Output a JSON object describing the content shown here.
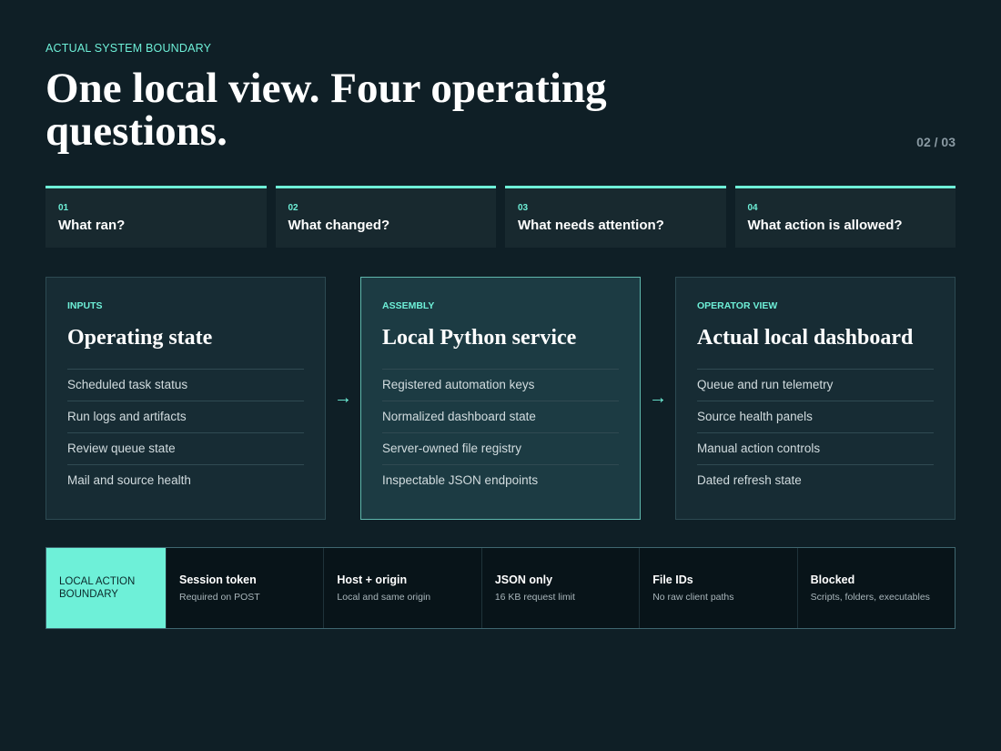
{
  "header": {
    "eyebrow": "ACTUAL SYSTEM BOUNDARY",
    "title": "One local view. Four operating questions.",
    "page": "02 / 03"
  },
  "questions": [
    {
      "num": "01",
      "text": "What ran?"
    },
    {
      "num": "02",
      "text": "What changed?"
    },
    {
      "num": "03",
      "text": "What needs attention?"
    },
    {
      "num": "04",
      "text": "What action is allowed?"
    }
  ],
  "flow": {
    "arrow": "→",
    "cards": [
      {
        "label": "INPUTS",
        "title": "Operating state",
        "items": [
          "Scheduled task status",
          "Run logs and artifacts",
          "Review queue state",
          "Mail and source health"
        ]
      },
      {
        "label": "ASSEMBLY",
        "title": "Local Python service",
        "items": [
          "Registered automation keys",
          "Normalized dashboard state",
          "Server-owned file registry",
          "Inspectable JSON endpoints"
        ]
      },
      {
        "label": "OPERATOR VIEW",
        "title": "Actual local dashboard",
        "items": [
          "Queue and run telemetry",
          "Source health panels",
          "Manual action controls",
          "Dated refresh state"
        ]
      }
    ]
  },
  "boundary": {
    "heading": "LOCAL ACTION BOUNDARY",
    "cells": [
      {
        "title": "Session token",
        "sub": "Required on POST"
      },
      {
        "title": "Host + origin",
        "sub": "Local and same origin"
      },
      {
        "title": "JSON only",
        "sub": "16 KB request limit"
      },
      {
        "title": "File IDs",
        "sub": "No raw client paths"
      },
      {
        "title": "Blocked",
        "sub": "Scripts, folders, executables"
      }
    ]
  },
  "colors": {
    "background": "#0f1f26",
    "accent": "#6ef0d8"
  }
}
